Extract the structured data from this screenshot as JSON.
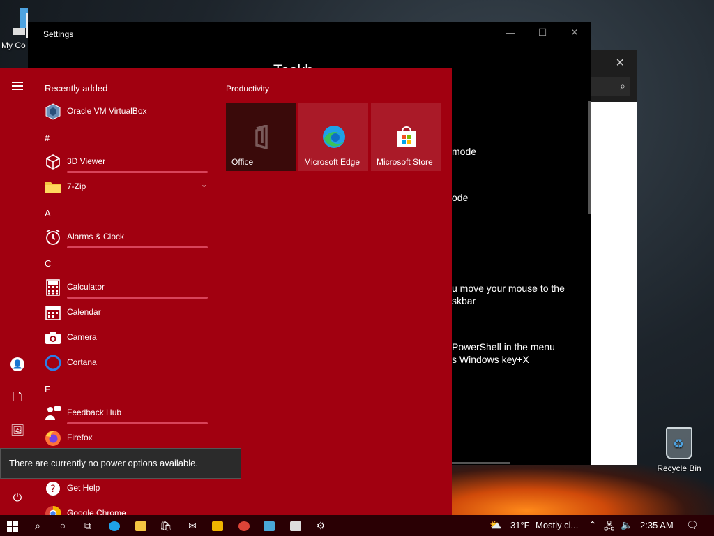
{
  "desktop": {
    "my_computer_label": "My Co",
    "recycle_bin_label": "Recycle Bin"
  },
  "settings_window": {
    "title": "Settings",
    "heading": "Taskb",
    "lines": [
      "mode",
      "ode",
      "u move your mouse to the\nskbar",
      "PowerShell in the menu\ns Windows key+X"
    ]
  },
  "start_menu": {
    "recently_added_label": "Recently added",
    "productivity_label": "Productivity",
    "sections": [
      {
        "letter": "",
        "apps": [
          {
            "label": "Oracle VM VirtualBox",
            "icon": "virtualbox-icon",
            "new": false
          }
        ]
      },
      {
        "letter": "#",
        "apps": [
          {
            "label": "3D Viewer",
            "icon": "cube-icon",
            "new": true
          },
          {
            "label": "7-Zip",
            "icon": "folder-icon",
            "new": false,
            "expandable": true
          }
        ]
      },
      {
        "letter": "A",
        "apps": [
          {
            "label": "Alarms & Clock",
            "icon": "alarm-icon",
            "new": true
          }
        ]
      },
      {
        "letter": "C",
        "apps": [
          {
            "label": "Calculator",
            "icon": "calculator-icon",
            "new": true
          },
          {
            "label": "Calendar",
            "icon": "calendar-icon",
            "new": false
          },
          {
            "label": "Camera",
            "icon": "camera-icon",
            "new": false
          },
          {
            "label": "Cortana",
            "icon": "cortana-icon",
            "new": false
          }
        ]
      },
      {
        "letter": "F",
        "apps": [
          {
            "label": "Feedback Hub",
            "icon": "feedback-icon",
            "new": true
          },
          {
            "label": "Firefox",
            "icon": "firefox-icon",
            "new": false
          }
        ]
      },
      {
        "letter": "",
        "apps": [
          {
            "label": "Get Help",
            "icon": "help-icon",
            "new": false
          },
          {
            "label": "Google Chrome",
            "icon": "chrome-icon",
            "new": false
          }
        ]
      }
    ],
    "tiles": [
      {
        "label": "Office",
        "icon": "office-icon"
      },
      {
        "label": "Microsoft Edge",
        "icon": "edge-icon"
      },
      {
        "label": "Microsoft Store",
        "icon": "store-icon"
      }
    ],
    "power_toast": "There are currently no power options available."
  },
  "taskbar": {
    "weather_temp": "31°F",
    "weather_text": "Mostly cl...",
    "clock": "2:35 AM"
  },
  "colors": {
    "start_bg": "#a10010",
    "new_app_bar": "#d8435a",
    "taskbar_bg": "#2a0004"
  }
}
